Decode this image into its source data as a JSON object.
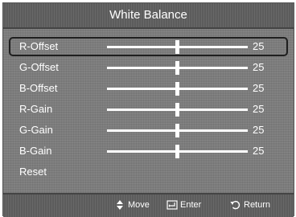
{
  "menu": {
    "title": "White Balance",
    "items": [
      {
        "label": "R-Offset",
        "value": "25",
        "level": 0.5,
        "selected": true
      },
      {
        "label": "G-Offset",
        "value": "25",
        "level": 0.5
      },
      {
        "label": "B-Offset",
        "value": "25",
        "level": 0.5
      },
      {
        "label": "R-Gain",
        "value": "25",
        "level": 0.5
      },
      {
        "label": "G-Gain",
        "value": "25",
        "level": 0.5
      },
      {
        "label": "B-Gain",
        "value": "25",
        "level": 0.5
      }
    ],
    "reset_label": "Reset"
  },
  "footer": {
    "move_label": "Move",
    "enter_label": "Enter",
    "return_label": "Return",
    "move_icon": "up-down-arrows-icon",
    "enter_icon": "enter-icon",
    "return_icon": "return-arrow-icon"
  },
  "colors": {
    "background": "#7c7c7c",
    "bars": "#5c5c5c",
    "text": "#ffffff"
  }
}
